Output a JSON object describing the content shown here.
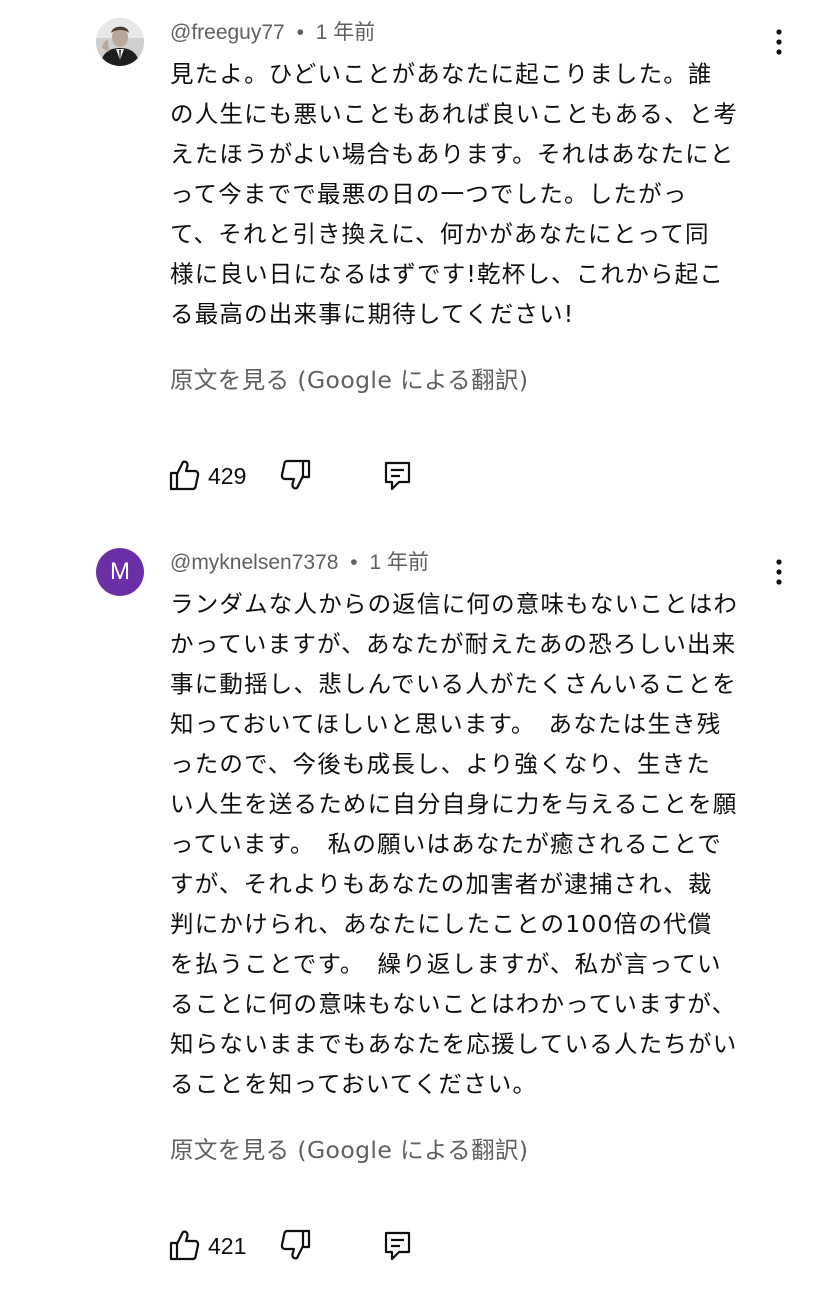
{
  "comments": [
    {
      "avatar": {
        "kind": "photo",
        "icon": "user-photo-avatar"
      },
      "handle": "@freeguy77",
      "separator": "•",
      "time": "1 年前",
      "text": "見たよ。ひどいことがあなたに起こりました。誰\nの人生にも悪いこともあれば良いこともある、と考\nえたほうがよい場合もあります。それはあなたにと\nって今までで最悪の日の一つでした。したがっ\nて、それと引き換えに、何かがあなたにとって同\n様に良い日になるはずです!乾杯し、これから起こ\nる最高の出来事に期待してください!",
      "translate_label": "原文を見る (Google による翻訳)",
      "likes": "429"
    },
    {
      "avatar": {
        "kind": "letter",
        "letter": "M",
        "color": "#6b2fa6"
      },
      "handle": "@myknelsen7378",
      "separator": "•",
      "time": "1 年前",
      "text": "ランダムな人からの返信に何の意味もないことはわ\nかっていますが、あなたが耐えたあの恐ろしい出来\n事に動揺し、悲しんでいる人がたくさんいることを\n知っておいてほしいと思います。　あなたは生き残\nったので、今後も成長し、より強くなり、生きた\nい人生を送るために自分自身に力を与えることを願\nっています。　私の願いはあなたが癒されることで\nすが、それよりもあなたの加害者が逮捕され、裁\n判にかけられ、あなたにしたことの100倍の代償\nを払うことです。　繰り返しますが、私が言ってい\nることに何の意味もないことはわかっていますが、\n知らないままでもあなたを応援している人たちがい\nることを知っておいてください。",
      "translate_label": "原文を見る (Google による翻訳)",
      "likes": "421"
    }
  ],
  "icons": {
    "like": "thumbs-up-icon",
    "dislike": "thumbs-down-icon",
    "reply": "reply-comment-icon",
    "more": "more-vertical-icon"
  }
}
